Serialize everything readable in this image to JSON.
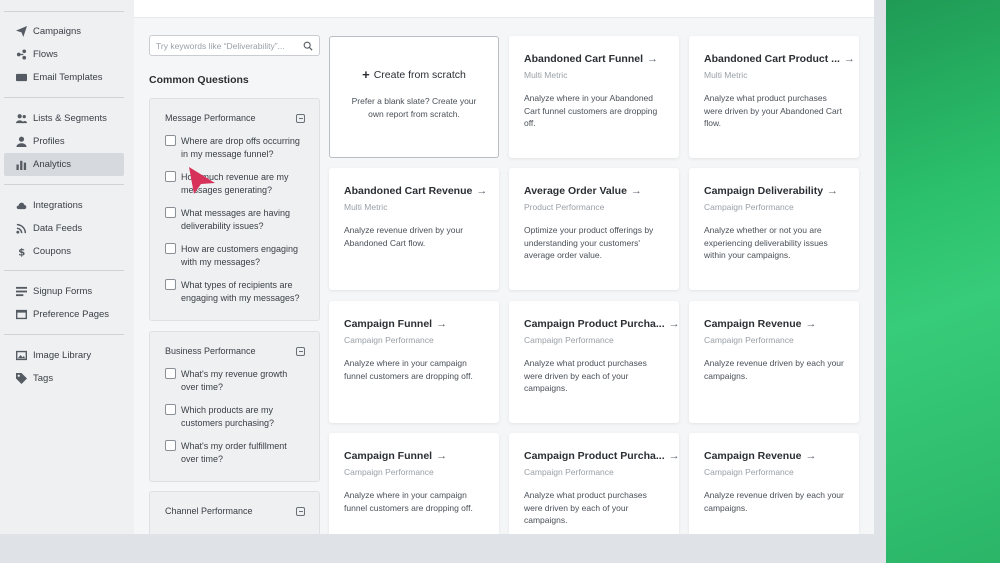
{
  "sidebar": {
    "groups": [
      [
        {
          "label": "Campaigns",
          "icon": "send-icon"
        },
        {
          "label": "Flows",
          "icon": "flows-icon"
        },
        {
          "label": "Email Templates",
          "icon": "email-icon"
        }
      ],
      [
        {
          "label": "Lists & Segments",
          "icon": "users-icon"
        },
        {
          "label": "Profiles",
          "icon": "profile-icon"
        },
        {
          "label": "Analytics",
          "icon": "chart-icon",
          "active": true
        }
      ],
      [
        {
          "label": "Integrations",
          "icon": "cloud-icon"
        },
        {
          "label": "Data Feeds",
          "icon": "feed-icon"
        },
        {
          "label": "Coupons",
          "icon": "dollar-icon"
        }
      ],
      [
        {
          "label": "Signup Forms",
          "icon": "form-icon"
        },
        {
          "label": "Preference Pages",
          "icon": "page-icon"
        }
      ],
      [
        {
          "label": "Image Library",
          "icon": "image-icon"
        },
        {
          "label": "Tags",
          "icon": "tag-icon"
        }
      ]
    ]
  },
  "search": {
    "placeholder": "Try keywords like “Deliverability”..."
  },
  "common_questions": {
    "title": "Common Questions"
  },
  "panels": [
    {
      "title": "Message Performance",
      "questions": [
        "Where are drop offs occurring in my message funnel?",
        "How much revenue are my messages generating?",
        "What messages are having deliverability issues?",
        "How are customers engaging with my messages?",
        "What types of recipients are engaging with my messages?"
      ]
    },
    {
      "title": "Business Performance",
      "questions": [
        "What's my revenue growth over time?",
        "Which products are my customers purchasing?",
        "What's my order fulfillment over time?"
      ]
    },
    {
      "title": "Channel Performance",
      "questions": []
    }
  ],
  "create": {
    "title": "Create from scratch",
    "desc": "Prefer a blank slate? Create your own report from scratch."
  },
  "cards": [
    {
      "title": "Abandoned Cart Funnel",
      "sub": "Multi Metric",
      "desc": "Analyze where in your Abandoned Cart funnel customers are dropping off."
    },
    {
      "title": "Abandoned Cart Product ...",
      "sub": "Multi Metric",
      "desc": "Analyze what product purchases were driven by your Abandoned Cart flow."
    },
    {
      "title": "Abandoned Cart Revenue",
      "sub": "Multi Metric",
      "desc": "Analyze revenue driven by your Abandoned Cart flow."
    },
    {
      "title": "Average Order Value",
      "sub": "Product Performance",
      "desc": "Optimize your product offerings by understanding your customers' average order value."
    },
    {
      "title": "Campaign Deliverability",
      "sub": "Campaign Performance",
      "desc": "Analyze whether or not you are experiencing deliverability issues within your campaigns."
    },
    {
      "title": "Campaign Funnel",
      "sub": "Campaign Performance",
      "desc": "Analyze where in your campaign funnel customers are dropping off."
    },
    {
      "title": "Campaign Product Purcha...",
      "sub": "Campaign Performance",
      "desc": "Analyze what product purchases were driven by each of your campaigns."
    },
    {
      "title": "Campaign Revenue",
      "sub": "Campaign Performance",
      "desc": "Analyze revenue driven by each your campaigns."
    },
    {
      "title": "Campaign Funnel",
      "sub": "Campaign Performance",
      "desc": "Analyze where in your campaign funnel customers are dropping off."
    },
    {
      "title": "Campaign Product Purcha...",
      "sub": "Campaign Performance",
      "desc": "Analyze what product purchases were driven by each of your campaigns."
    },
    {
      "title": "Campaign Revenue",
      "sub": "Campaign Performance",
      "desc": "Analyze revenue driven by each your campaigns."
    }
  ],
  "colors": {
    "accent_green": "#2bc06b",
    "cursor": "#d6325a"
  }
}
